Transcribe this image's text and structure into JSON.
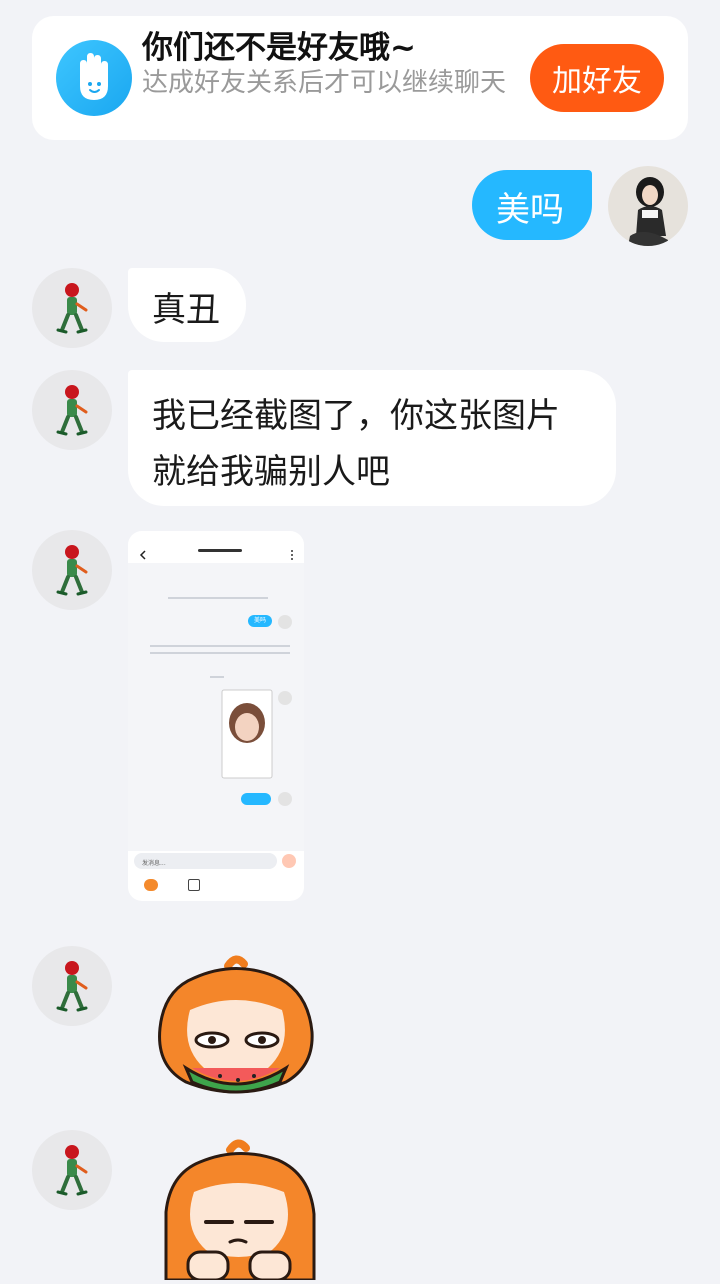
{
  "banner": {
    "title": "你们还不是好友哦~",
    "subtitle": "达成好友关系后才可以继续聊天",
    "add_button": "加好友",
    "icon": "waving-hand-icon"
  },
  "colors": {
    "accent_blue": "#25b8ff",
    "add_button": "#ff5a12",
    "background": "#f2f3f7"
  },
  "messages": [
    {
      "side": "right",
      "text": "美吗"
    },
    {
      "side": "left",
      "text": "真丑"
    },
    {
      "side": "left",
      "text": "我已经截图了，你这张图片就给我骗别人吧"
    },
    {
      "side": "left",
      "type": "image",
      "content": "screenshot-of-chat"
    },
    {
      "side": "left",
      "type": "sticker",
      "content": "eating-watermelon-sticker"
    },
    {
      "side": "left",
      "type": "sticker",
      "content": "sleepy-sticker"
    }
  ],
  "screenshot_preview": {
    "my_message": "美吗",
    "input_placeholder": "发消息..."
  }
}
